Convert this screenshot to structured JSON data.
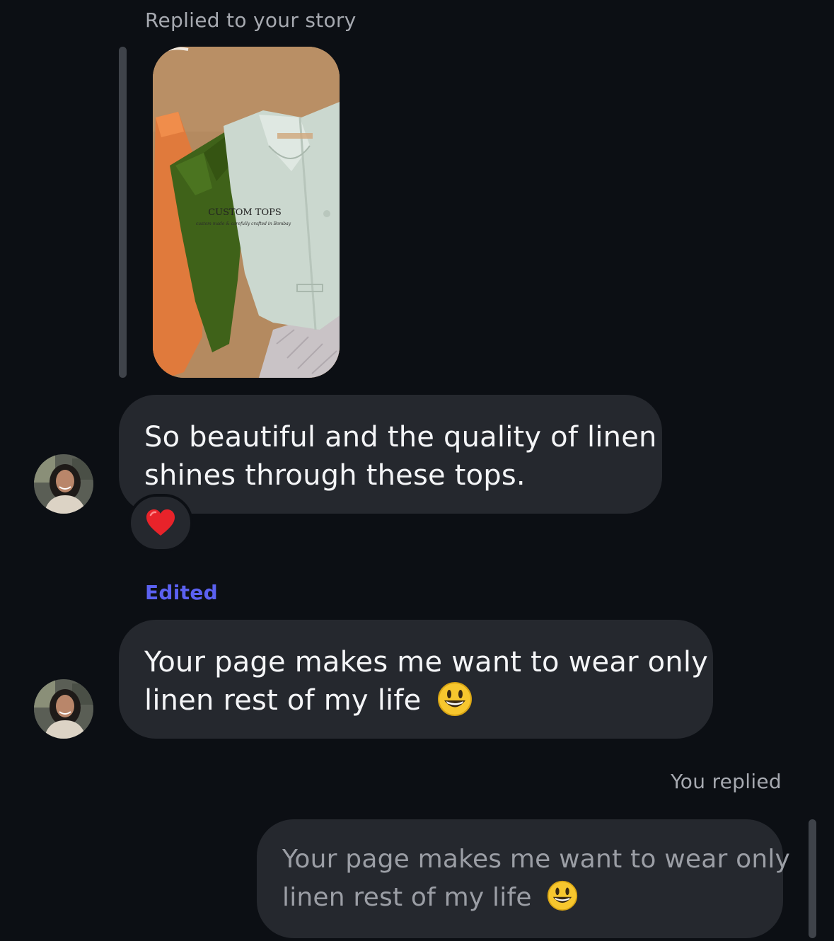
{
  "story_reply": {
    "meta_label": "Replied to your story",
    "thumbnail": {
      "caption": "CUSTOM TOPS",
      "tagline": "custom made & carefully crafted in Bombay"
    }
  },
  "messages": [
    {
      "sender": "other",
      "lines": [
        "So beautiful and the quality of linen",
        "shines through these tops."
      ],
      "reaction": "heart-icon"
    },
    {
      "sender": "other",
      "status_label": "Edited",
      "lines": [
        "Your page makes me want to wear only",
        "linen rest of my life"
      ],
      "trailing_emoji": "smiley-icon"
    }
  ],
  "reply": {
    "meta_label": "You replied",
    "quoted_lines": [
      "Your page makes me want to wear only",
      "linen rest of my life"
    ],
    "trailing_emoji": "smiley-icon"
  },
  "colors": {
    "background": "#0c0f14",
    "bubble": "#25282e",
    "edited_accent": "#5b61f0",
    "meta_text": "#a6a9b0"
  }
}
